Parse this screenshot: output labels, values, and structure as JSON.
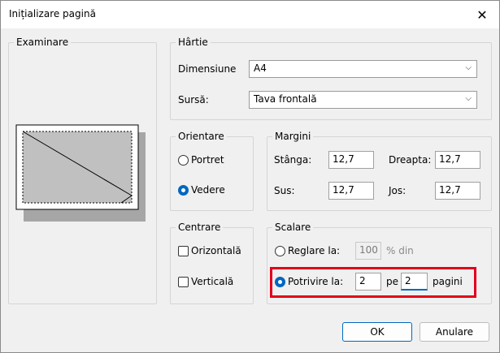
{
  "window": {
    "title": "Inițializare pagină",
    "close_icon": "close-icon"
  },
  "preview": {
    "legend": "Examinare"
  },
  "paper": {
    "legend": "Hârtie",
    "size_label": "Dimensiune",
    "size_value": "A4",
    "source_label": "Sursă:",
    "source_value": "Tava frontală"
  },
  "orientation": {
    "legend": "Orientare",
    "portrait_label": "Portret",
    "landscape_label": "Vedere",
    "selected": "landscape"
  },
  "margins": {
    "legend": "Margini",
    "left_label": "Stânga:",
    "left_value": "12,7",
    "right_label": "Dreapta:",
    "right_value": "12,7",
    "top_label": "Sus:",
    "top_value": "12,7",
    "bottom_label": "Jos:",
    "bottom_value": "12,7"
  },
  "centering": {
    "legend": "Centrare",
    "horizontal_label": "Orizontală",
    "vertical_label": "Verticală"
  },
  "scaling": {
    "legend": "Scalare",
    "adjust_label": "Reglare la:",
    "adjust_value": "100",
    "adjust_suffix": "% din",
    "fit_label": "Potrivire la:",
    "fit_pages_wide": "2",
    "fit_by": "pe",
    "fit_pages_tall": "2",
    "fit_suffix": "pagini",
    "selected": "fit"
  },
  "buttons": {
    "ok": "OK",
    "cancel": "Anulare"
  }
}
